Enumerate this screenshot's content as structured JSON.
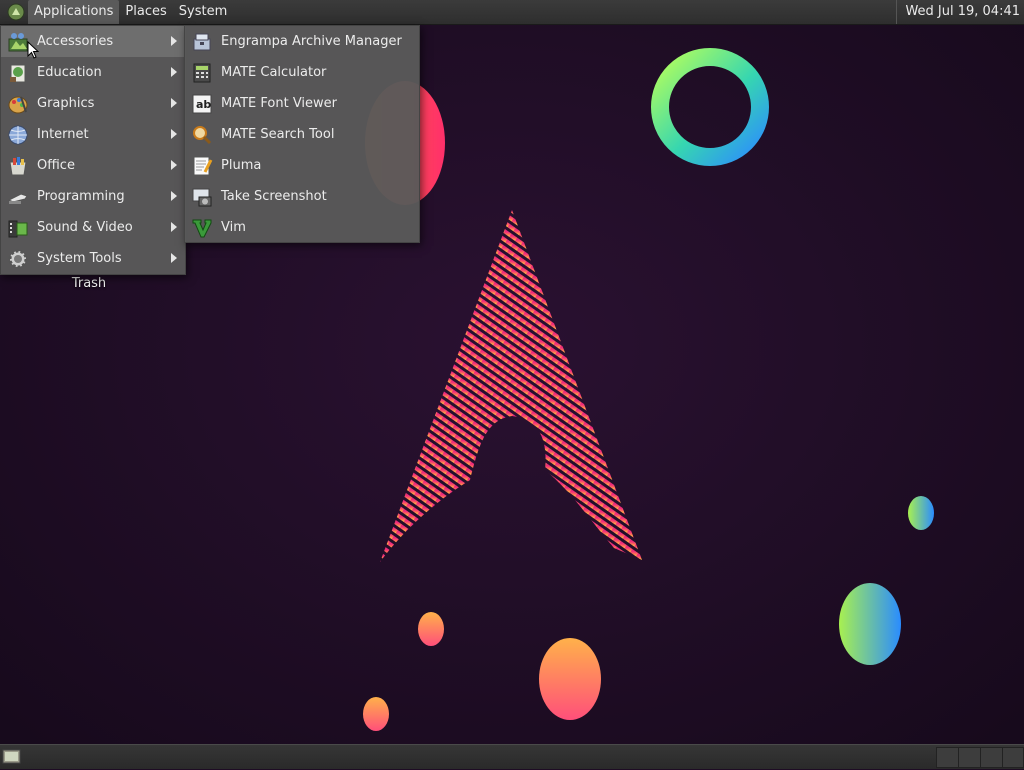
{
  "top_panel": {
    "menus": [
      "Applications",
      "Places",
      "System"
    ],
    "clock": "Wed Jul 19, 04:41"
  },
  "desktop": {
    "trash_label": "Trash"
  },
  "applications_menu": {
    "categories": [
      {
        "label": "Accessories",
        "icon": "accessories-icon"
      },
      {
        "label": "Education",
        "icon": "education-icon"
      },
      {
        "label": "Graphics",
        "icon": "graphics-icon"
      },
      {
        "label": "Internet",
        "icon": "internet-icon"
      },
      {
        "label": "Office",
        "icon": "office-icon"
      },
      {
        "label": "Programming",
        "icon": "programming-icon"
      },
      {
        "label": "Sound & Video",
        "icon": "sound-video-icon"
      },
      {
        "label": "System Tools",
        "icon": "system-tools-icon"
      }
    ],
    "selected": "Accessories"
  },
  "accessories_submenu": {
    "items": [
      {
        "label": "Engrampa Archive Manager",
        "icon": "archive-manager-icon"
      },
      {
        "label": "MATE Calculator",
        "icon": "calculator-icon"
      },
      {
        "label": "MATE Font Viewer",
        "icon": "font-viewer-icon"
      },
      {
        "label": "MATE Search Tool",
        "icon": "search-tool-icon"
      },
      {
        "label": "Pluma",
        "icon": "text-editor-icon"
      },
      {
        "label": "Take Screenshot",
        "icon": "screenshot-icon"
      },
      {
        "label": "Vim",
        "icon": "vim-icon"
      }
    ]
  },
  "colors": {
    "panel": "#2e2e2e",
    "menu_bg": "#5a5a5a",
    "menu_selected": "#6e6e6e",
    "wallpaper_bg": "#1e0c24",
    "accent_pink": "#e0287a",
    "accent_orange": "#ff7a3c"
  }
}
